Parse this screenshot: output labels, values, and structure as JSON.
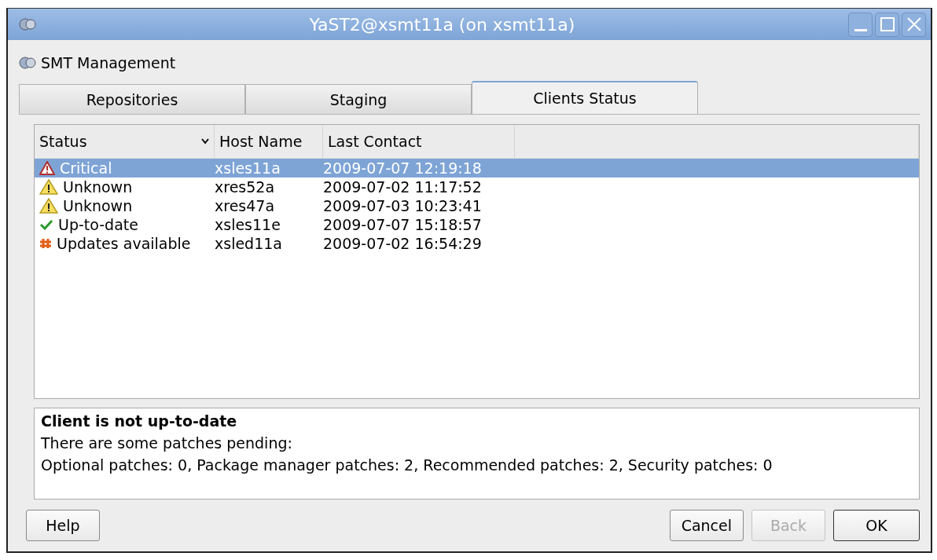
{
  "window": {
    "title": "YaST2@xsmt11a (on xsmt11a)"
  },
  "module": {
    "title": "SMT Management"
  },
  "tabs": [
    {
      "label": "Repositories",
      "selected": false
    },
    {
      "label": "Staging",
      "selected": false
    },
    {
      "label": "Clients Status",
      "selected": true
    }
  ],
  "table": {
    "columns": [
      "Status",
      "Host Name",
      "Last Contact"
    ],
    "rows": [
      {
        "kind": "critical",
        "status": "Critical",
        "host": "xsles11a",
        "last_contact": "2009-07-07 12:19:18",
        "selected": true
      },
      {
        "kind": "unknown",
        "status": "Unknown",
        "host": "xres52a",
        "last_contact": "2009-07-02 11:17:52",
        "selected": false
      },
      {
        "kind": "unknown",
        "status": "Unknown",
        "host": "xres47a",
        "last_contact": "2009-07-03 10:23:41",
        "selected": false
      },
      {
        "kind": "ok",
        "status": "Up-to-date",
        "host": "xsles11e",
        "last_contact": "2009-07-07 15:18:57",
        "selected": false
      },
      {
        "kind": "updates",
        "status": "Updates available",
        "host": "xsled11a",
        "last_contact": "2009-07-02 16:54:29",
        "selected": false
      }
    ]
  },
  "details": {
    "heading": "Client is not up-to-date",
    "lines": [
      "There are some patches pending:",
      "Optional patches: 0, Package manager patches: 2, Recommended patches: 2, Security patches: 0"
    ]
  },
  "buttons": [
    {
      "label": "Help",
      "disabled": false
    },
    {
      "label": "Cancel",
      "disabled": false
    },
    {
      "label": "Back",
      "disabled": true
    },
    {
      "label": "OK",
      "disabled": false
    }
  ]
}
